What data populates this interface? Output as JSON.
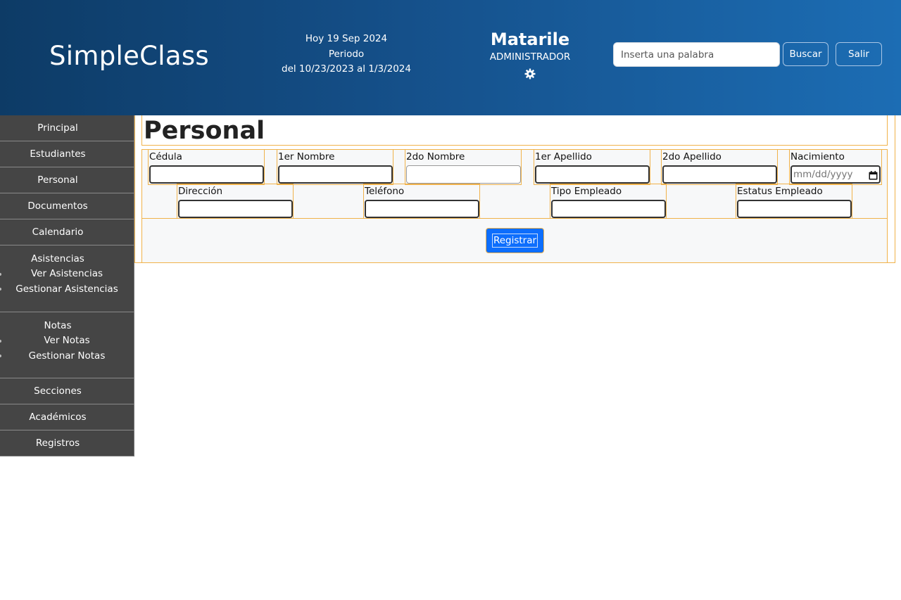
{
  "header": {
    "brand": "SimpleClass",
    "date_line": "Hoy 19 Sep 2024",
    "period_label": "Periodo",
    "period_range": "del 10/23/2023 al 1/3/2024",
    "username": "Matarile",
    "role": "ADMINISTRADOR",
    "settings_icon": "gear-icon",
    "search_placeholder": "Inserta una palabra",
    "search_value": "",
    "search_button": "Buscar",
    "exit_button": "Salir"
  },
  "sidebar": {
    "items": [
      {
        "label": "Principal"
      },
      {
        "label": "Estudiantes"
      },
      {
        "label": "Personal"
      },
      {
        "label": "Documentos"
      },
      {
        "label": "Calendario"
      }
    ],
    "asistencias": {
      "label": "Asistencias",
      "subs": [
        "Ver Asistencias",
        "Gestionar Asistencias"
      ]
    },
    "notas": {
      "label": "Notas",
      "subs": [
        "Ver Notas",
        "Gestionar Notas"
      ]
    },
    "bottom_items": [
      {
        "label": "Secciones"
      },
      {
        "label": "Académicos"
      },
      {
        "label": "Registros"
      }
    ]
  },
  "main": {
    "title": "Personal",
    "fields": {
      "cedula": {
        "label": "Cédula",
        "value": ""
      },
      "nombre1": {
        "label": "1er Nombre",
        "value": ""
      },
      "nombre2": {
        "label": "2do Nombre",
        "value": ""
      },
      "apellido1": {
        "label": "1er Apellido",
        "value": ""
      },
      "apellido2": {
        "label": "2do Apellido",
        "value": ""
      },
      "nacimiento": {
        "label": "Nacimiento",
        "placeholder": "mm/dd/yyyy"
      },
      "direccion": {
        "label": "Dirección",
        "value": ""
      },
      "telefono": {
        "label": "Teléfono",
        "value": ""
      },
      "tipo_empleado": {
        "label": "Tipo Empleado",
        "value": ""
      },
      "estatus_empleado": {
        "label": "Estatus Empleado",
        "value": ""
      }
    },
    "register_button": "Registrar"
  }
}
